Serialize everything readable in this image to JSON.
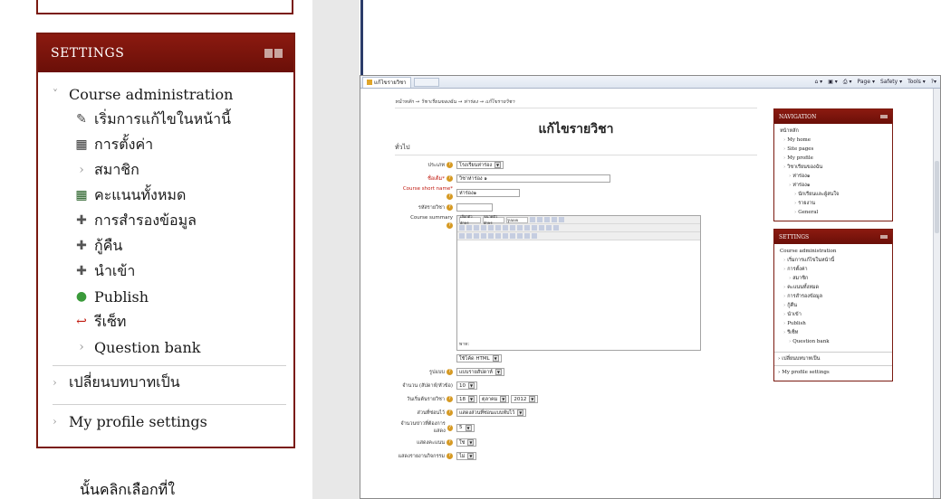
{
  "zoom_panel": {
    "header": "SETTINGS",
    "course_admin": "Course administration",
    "items": [
      {
        "label": "เริ่มการแก้ไขในหน้านี้",
        "icon": "pencil-icon",
        "glyph": "✎",
        "color": "#444444"
      },
      {
        "label": "การตั้งค่า",
        "icon": "settings-grid-icon",
        "glyph": "▦",
        "color": "#333333"
      },
      {
        "label": "สมาชิก",
        "icon": "caret-icon",
        "glyph": "›",
        "color": "#999999"
      },
      {
        "label": "คะแนนทั้งหมด",
        "icon": "grades-icon",
        "glyph": "▦",
        "color": "#1e5a1e"
      },
      {
        "label": "การสำรองข้อมูล",
        "icon": "backup-icon",
        "glyph": "✚",
        "color": "#555555"
      },
      {
        "label": "กู้คืน",
        "icon": "restore-icon",
        "glyph": "✚",
        "color": "#555555"
      },
      {
        "label": "นำเข้า",
        "icon": "import-icon",
        "glyph": "✚",
        "color": "#555555"
      },
      {
        "label": "Publish",
        "icon": "publish-globe-icon",
        "glyph": "●",
        "color": "#3a9a3a"
      },
      {
        "label": "รีเซ็ท",
        "icon": "reset-arrow-icon",
        "glyph": "↩",
        "color": "#c0190f"
      },
      {
        "label": "Question bank",
        "icon": "caret-icon",
        "glyph": "›",
        "color": "#999999"
      }
    ],
    "switch_role": "เปลี่ยนบทบาทเป็น",
    "profile_settings": "My profile settings",
    "bottom_text": "นั้นคลิกเลือกที่ใ"
  },
  "browser": {
    "tab_title": "แก้ไขรายวิชา",
    "toolbar": {
      "page": "Page ▾",
      "safety": "Safety ▾",
      "tools": "Tools ▾"
    }
  },
  "form": {
    "breadcrumb": "หน้าหลัก → วิชาเรียนของฉัน → ห่าร่อง → แก้ไขรายวิชา",
    "title": "แก้ไขรายวิชา",
    "section": "ทั่วไป",
    "category_label": "ประเภท",
    "category_value": "โรงเรียนห่าร่อง",
    "fullname_label": "ชื่อเต็ม*",
    "fullname_value": "วิชาห่าร่อง ๑",
    "shortname_label": "Course short name*",
    "shortname_value": "ห่าร่อง๑",
    "idnumber_label": "รหัสรายวิชา",
    "summary_label": "Course summary",
    "editor_font": "เลือกตัวอักษร",
    "editor_size": "ขนาดตัวอักษร",
    "editor_format": "รูปแบบ",
    "editor_path": "พาท:",
    "format_html": "ใช้โค้ด HTML",
    "courseformat_label": "รูปแบบ",
    "courseformat_value": "แบบรายสัปดาห์",
    "numsections_label": "จำนวน (สัปดาห์/หัวข้อ)",
    "numsections_value": "10",
    "startdate_label": "วันเริ่มต้นรายวิชา",
    "start_day": "18",
    "start_month": "ตุลาคม",
    "start_year": "2012",
    "hidden_label": "ส่วนที่ซ่อนไว้",
    "hidden_value": "แสดงส่วนที่ซ่อนแบบพับไว้",
    "news_label": "จำนวนข่าวที่ต้องการแสดง",
    "news_value": "5",
    "grades_label": "แสดงคะแนน",
    "grades_value": "ใช่",
    "reports_label": "แสดงรายงานกิจกรรม",
    "reports_value": "ไม่"
  },
  "side": {
    "nav_header": "NAVIGATION",
    "nav_items": [
      {
        "label": "หน้าหลัก",
        "level": 0
      },
      {
        "label": "My home",
        "level": 1
      },
      {
        "label": "Site pages",
        "level": 1
      },
      {
        "label": "My profile",
        "level": 1
      },
      {
        "label": "วิชาเรียนของฉัน",
        "level": 1
      },
      {
        "label": "ห่าร่อง๑",
        "level": 2
      },
      {
        "label": "ห่าร่อง๑",
        "level": 2
      },
      {
        "label": "นักเรียนและผู้สนใจ",
        "level": 3
      },
      {
        "label": "รายงาน",
        "level": 3
      },
      {
        "label": "General",
        "level": 3
      }
    ],
    "settings_header": "SETTINGS",
    "settings_items": [
      {
        "label": "Course administration",
        "level": 0
      },
      {
        "label": "เริ่มการแก้ไขในหน้านี้",
        "level": 1
      },
      {
        "label": "การตั้งค่า",
        "level": 1
      },
      {
        "label": "สมาชิก",
        "level": 2
      },
      {
        "label": "คะแนนทั้งหมด",
        "level": 1
      },
      {
        "label": "การสำรองข้อมูล",
        "level": 1
      },
      {
        "label": "กู้คืน",
        "level": 1
      },
      {
        "label": "นำเข้า",
        "level": 1
      },
      {
        "label": "Publish",
        "level": 1
      },
      {
        "label": "รีเซ็ท",
        "level": 1
      },
      {
        "label": "Question bank",
        "level": 2
      }
    ],
    "switch_role": "เปลี่ยนบทบาทเป็น",
    "profile_settings": "My profile settings"
  }
}
